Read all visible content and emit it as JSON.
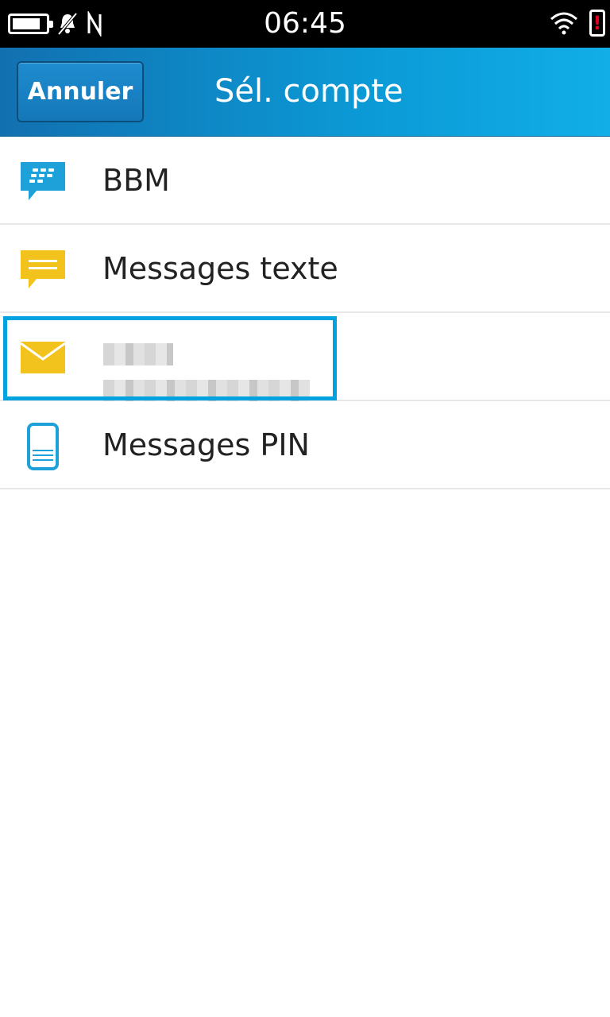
{
  "status_bar": {
    "time": "06:45",
    "icons": [
      "battery-icon",
      "notifications-off-icon",
      "nfc-icon",
      "wifi-icon",
      "alert-icon"
    ],
    "alert_text": "!"
  },
  "header": {
    "cancel_label": "Annuler",
    "title": "Sél. compte",
    "accent_color": "#0b9ad6"
  },
  "accounts": [
    {
      "label": "BBM",
      "icon": "bbm-icon",
      "icon_color": "#1da1d8"
    },
    {
      "label": "Messages texte",
      "icon": "text-message-icon",
      "icon_color": "#f2c21d"
    },
    {
      "label": "",
      "icon": "email-icon",
      "icon_color": "#f2c21d",
      "selected": true,
      "redacted": true
    },
    {
      "label": "Messages PIN",
      "icon": "pin-message-icon",
      "icon_color": "#1da1d8"
    }
  ],
  "colors": {
    "focus_ring": "#00a2e0"
  }
}
